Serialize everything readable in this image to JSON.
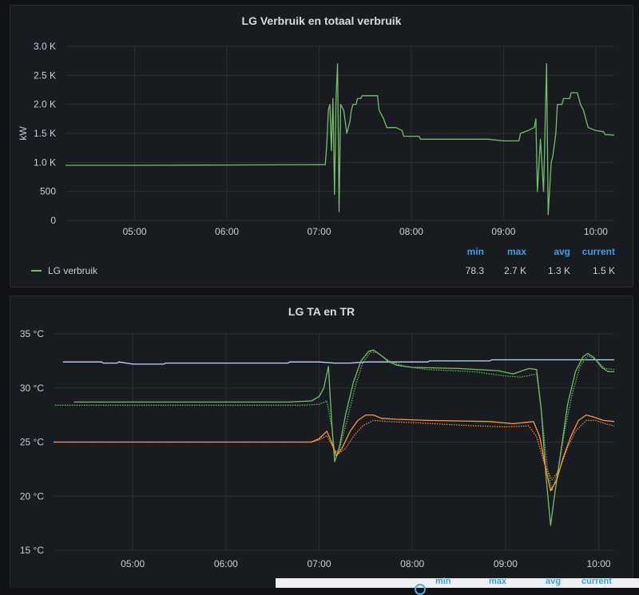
{
  "panels": [
    {
      "title": "LG Verbruik en totaal verbruik",
      "legend": {
        "name": "LG verbruik",
        "color": "#73bf69"
      },
      "stats_headers": [
        "min",
        "max",
        "avg",
        "current"
      ],
      "stats_values": [
        "78.3",
        "2.7 K",
        "1.3 K",
        "1.5 K"
      ]
    },
    {
      "title": "LG TA en TR",
      "stats_headers": [
        "min",
        "max",
        "avg",
        "current"
      ]
    }
  ],
  "colors": {
    "green": "#73bf69",
    "orange": "#ff9830",
    "lavender": "#c0d8ff",
    "stat_header": "#33a2e5"
  },
  "chart_data": [
    {
      "type": "line",
      "title": "LG Verbruik en totaal verbruik",
      "xlabel": "",
      "ylabel": "kW",
      "x_ticks": [
        "05:00",
        "06:00",
        "07:00",
        "08:00",
        "09:00",
        "10:00"
      ],
      "y_ticks": [
        "0",
        "500",
        "1.0 K",
        "1.5 K",
        "2.0 K",
        "2.5 K",
        "3.0 K"
      ],
      "xlim": [
        "04:15",
        "10:12"
      ],
      "ylim": [
        0,
        3000
      ],
      "grid": true,
      "legend_placement": "bottom-left",
      "series": [
        {
          "name": "LG verbruik",
          "color": "#73bf69",
          "points": [
            [
              "04:15",
              950
            ],
            [
              "05:00",
              950
            ],
            [
              "06:00",
              955
            ],
            [
              "07:00",
              960
            ],
            [
              "07:04",
              960
            ],
            [
              "07:05",
              1300
            ],
            [
              "07:06",
              1900
            ],
            [
              "07:07",
              2000
            ],
            [
              "07:08",
              1200
            ],
            [
              "07:09",
              2100
            ],
            [
              "07:10",
              450
            ],
            [
              "07:11",
              2100
            ],
            [
              "07:12",
              2700
            ],
            [
              "07:13",
              150
            ],
            [
              "07:14",
              2000
            ],
            [
              "07:16",
              1900
            ],
            [
              "07:18",
              1500
            ],
            [
              "07:20",
              1700
            ],
            [
              "07:21",
              1900
            ],
            [
              "07:22",
              2000
            ],
            [
              "07:24",
              2000
            ],
            [
              "07:25",
              2100
            ],
            [
              "07:27",
              2100
            ],
            [
              "07:28",
              2150
            ],
            [
              "07:38",
              2150
            ],
            [
              "07:39",
              1900
            ],
            [
              "07:42",
              1750
            ],
            [
              "07:44",
              1600
            ],
            [
              "07:50",
              1600
            ],
            [
              "07:54",
              1550
            ],
            [
              "07:55",
              1450
            ],
            [
              "08:05",
              1450
            ],
            [
              "08:06",
              1400
            ],
            [
              "08:50",
              1400
            ],
            [
              "09:00",
              1370
            ],
            [
              "09:10",
              1370
            ],
            [
              "09:11",
              1500
            ],
            [
              "09:16",
              1550
            ],
            [
              "09:20",
              1600
            ],
            [
              "09:21",
              1750
            ],
            [
              "09:22",
              500
            ],
            [
              "09:24",
              1400
            ],
            [
              "09:26",
              500
            ],
            [
              "09:28",
              2700
            ],
            [
              "09:29",
              100
            ],
            [
              "09:31",
              1000
            ],
            [
              "09:32",
              1100
            ],
            [
              "09:34",
              1500
            ],
            [
              "09:35",
              2000
            ],
            [
              "09:38",
              2000
            ],
            [
              "09:39",
              2100
            ],
            [
              "09:43",
              2100
            ],
            [
              "09:44",
              2200
            ],
            [
              "09:48",
              2200
            ],
            [
              "09:50",
              2000
            ],
            [
              "09:52",
              1900
            ],
            [
              "09:55",
              1600
            ],
            [
              "10:00",
              1550
            ],
            [
              "10:05",
              1530
            ],
            [
              "10:06",
              1480
            ],
            [
              "10:12",
              1470
            ]
          ]
        }
      ]
    },
    {
      "type": "line",
      "title": "LG TA en TR",
      "xlabel": "",
      "ylabel": "",
      "x_ticks": [
        "05:00",
        "06:00",
        "07:00",
        "08:00",
        "09:00",
        "10:00"
      ],
      "y_ticks": [
        "15 °C",
        "20 °C",
        "25 °C",
        "30 °C",
        "35 °C"
      ],
      "xlim": [
        "04:09",
        "10:10"
      ],
      "ylim": [
        15,
        35
      ],
      "grid": true,
      "series": [
        {
          "color": "#c0d8ff",
          "style": "solid",
          "points": [
            [
              "04:15",
              32.4
            ],
            [
              "04:40",
              32.4
            ],
            [
              "04:41",
              32.3
            ],
            [
              "04:50",
              32.3
            ],
            [
              "04:51",
              32.4
            ],
            [
              "05:00",
              32.2
            ],
            [
              "05:20",
              32.2
            ],
            [
              "05:21",
              32.3
            ],
            [
              "06:40",
              32.3
            ],
            [
              "06:41",
              32.4
            ],
            [
              "07:00",
              32.4
            ],
            [
              "07:10",
              32.3
            ],
            [
              "07:20",
              32.3
            ],
            [
              "07:30",
              32.4
            ],
            [
              "08:10",
              32.4
            ],
            [
              "08:11",
              32.5
            ],
            [
              "08:50",
              32.5
            ],
            [
              "08:51",
              32.6
            ],
            [
              "10:10",
              32.6
            ]
          ]
        },
        {
          "color": "#73bf69",
          "style": "solid",
          "points": [
            [
              "04:22",
              28.7
            ],
            [
              "06:40",
              28.7
            ],
            [
              "06:55",
              28.8
            ],
            [
              "07:00",
              29.2
            ],
            [
              "07:03",
              30.0
            ],
            [
              "07:05",
              31.3
            ],
            [
              "07:06",
              32.0
            ],
            [
              "07:08",
              27.0
            ],
            [
              "07:10",
              23.2
            ],
            [
              "07:13",
              24.5
            ],
            [
              "07:17",
              27.5
            ],
            [
              "07:22",
              30.5
            ],
            [
              "07:27",
              32.5
            ],
            [
              "07:32",
              33.4
            ],
            [
              "07:35",
              33.5
            ],
            [
              "07:40",
              33.0
            ],
            [
              "07:45",
              32.4
            ],
            [
              "07:50",
              32.1
            ],
            [
              "08:00",
              31.9
            ],
            [
              "08:30",
              31.8
            ],
            [
              "08:55",
              31.6
            ],
            [
              "09:05",
              31.3
            ],
            [
              "09:15",
              31.8
            ],
            [
              "09:20",
              31.7
            ],
            [
              "09:23",
              28.0
            ],
            [
              "09:26",
              22.0
            ],
            [
              "09:29",
              17.3
            ],
            [
              "09:32",
              20.5
            ],
            [
              "09:36",
              24.5
            ],
            [
              "09:40",
              28.5
            ],
            [
              "09:45",
              31.5
            ],
            [
              "09:50",
              32.9
            ],
            [
              "09:53",
              33.2
            ],
            [
              "09:57",
              32.8
            ],
            [
              "10:02",
              31.9
            ],
            [
              "10:06",
              31.5
            ],
            [
              "10:10",
              31.5
            ]
          ]
        },
        {
          "color": "#73bf69",
          "style": "dotted",
          "points": [
            [
              "04:10",
              28.4
            ],
            [
              "06:50",
              28.4
            ],
            [
              "07:00",
              28.5
            ],
            [
              "07:05",
              28.8
            ],
            [
              "07:08",
              26.5
            ],
            [
              "07:10",
              24.0
            ],
            [
              "07:13",
              24.3
            ],
            [
              "07:18",
              27.0
            ],
            [
              "07:23",
              30.0
            ],
            [
              "07:28",
              32.3
            ],
            [
              "07:33",
              33.3
            ],
            [
              "07:37",
              33.3
            ],
            [
              "07:45",
              32.5
            ],
            [
              "07:55",
              32.0
            ],
            [
              "08:10",
              31.7
            ],
            [
              "08:40",
              31.5
            ],
            [
              "09:00",
              31.1
            ],
            [
              "09:10",
              31.0
            ],
            [
              "09:20",
              31.3
            ],
            [
              "09:23",
              28.0
            ],
            [
              "09:27",
              22.5
            ],
            [
              "09:30",
              20.5
            ],
            [
              "09:34",
              22.5
            ],
            [
              "09:38",
              26.0
            ],
            [
              "09:43",
              29.5
            ],
            [
              "09:48",
              32.0
            ],
            [
              "09:53",
              33.0
            ],
            [
              "09:58",
              32.6
            ],
            [
              "10:04",
              31.8
            ],
            [
              "10:10",
              31.7
            ]
          ]
        },
        {
          "color": "#ff9830",
          "style": "solid",
          "points": [
            [
              "04:09",
              25.0
            ],
            [
              "06:55",
              25.0
            ],
            [
              "07:00",
              25.3
            ],
            [
              "07:05",
              26.0
            ],
            [
              "07:08",
              25.0
            ],
            [
              "07:11",
              23.7
            ],
            [
              "07:15",
              24.5
            ],
            [
              "07:20",
              26.0
            ],
            [
              "07:25",
              27.0
            ],
            [
              "07:30",
              27.5
            ],
            [
              "07:35",
              27.5
            ],
            [
              "07:40",
              27.2
            ],
            [
              "07:50",
              27.1
            ],
            [
              "08:10",
              27.0
            ],
            [
              "08:50",
              26.9
            ],
            [
              "09:05",
              26.7
            ],
            [
              "09:18",
              26.9
            ],
            [
              "09:22",
              25.5
            ],
            [
              "09:26",
              22.5
            ],
            [
              "09:29",
              20.5
            ],
            [
              "09:33",
              21.5
            ],
            [
              "09:37",
              23.5
            ],
            [
              "09:42",
              25.5
            ],
            [
              "09:47",
              27.0
            ],
            [
              "09:52",
              27.5
            ],
            [
              "09:57",
              27.3
            ],
            [
              "10:03",
              27.0
            ],
            [
              "10:10",
              26.9
            ]
          ]
        },
        {
          "color": "#ff9830",
          "style": "dotted",
          "points": [
            [
              "04:09",
              25.0
            ],
            [
              "06:55",
              25.0
            ],
            [
              "07:00",
              25.2
            ],
            [
              "07:05",
              25.6
            ],
            [
              "07:09",
              24.5
            ],
            [
              "07:12",
              23.9
            ],
            [
              "07:17",
              24.4
            ],
            [
              "07:22",
              25.5
            ],
            [
              "07:28",
              26.5
            ],
            [
              "07:35",
              27.0
            ],
            [
              "07:45",
              26.9
            ],
            [
              "08:00",
              26.8
            ],
            [
              "08:40",
              26.5
            ],
            [
              "09:00",
              26.4
            ],
            [
              "09:15",
              26.5
            ],
            [
              "09:20",
              25.5
            ],
            [
              "09:25",
              23.0
            ],
            [
              "09:30",
              21.5
            ],
            [
              "09:35",
              22.5
            ],
            [
              "09:40",
              24.5
            ],
            [
              "09:45",
              26.0
            ],
            [
              "09:52",
              27.0
            ],
            [
              "09:58",
              27.0
            ],
            [
              "10:04",
              26.7
            ],
            [
              "10:10",
              26.5
            ]
          ]
        }
      ]
    }
  ]
}
